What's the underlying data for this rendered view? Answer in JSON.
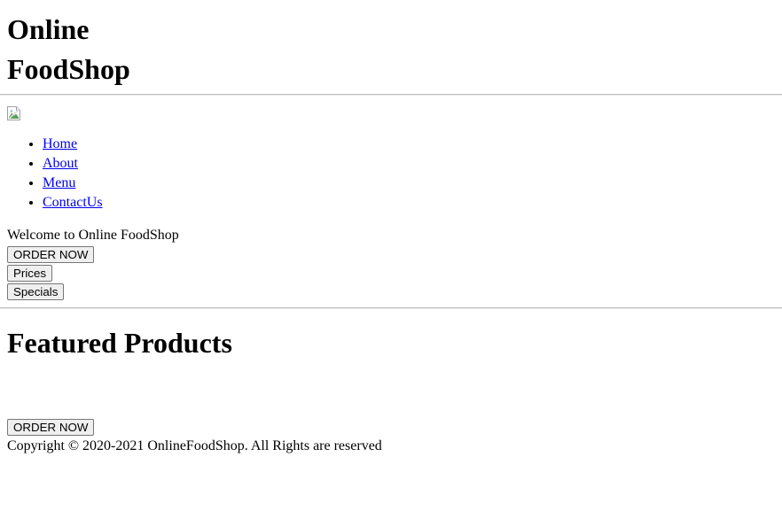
{
  "header": {
    "title_line1": "Online",
    "title_line2": "FoodShop",
    "logo_alt": "broken-image-placeholder"
  },
  "nav": {
    "items": [
      {
        "label": "Home",
        "name": "nav-link-home"
      },
      {
        "label": "About",
        "name": "nav-link-about"
      },
      {
        "label": "Menu",
        "name": "nav-link-menu"
      },
      {
        "label": "ContactUs",
        "name": "nav-link-contactus"
      }
    ]
  },
  "hero": {
    "welcome_text": "Welcome to Online FoodShop",
    "order_now_label": "ORDER NOW",
    "prices_label": "Prices",
    "specials_label": "Specials"
  },
  "featured": {
    "heading": "Featured Products",
    "order_now_label": "ORDER NOW"
  },
  "footer": {
    "copyright": "Copyright © 2020-2021 OnlineFoodShop. All Rights are reserved"
  },
  "colors": {
    "link": "#0000EE",
    "text": "#000000",
    "button_face": "#efefef",
    "button_border": "#767676",
    "rule": "#c0c0c0",
    "background": "#ffffff"
  }
}
